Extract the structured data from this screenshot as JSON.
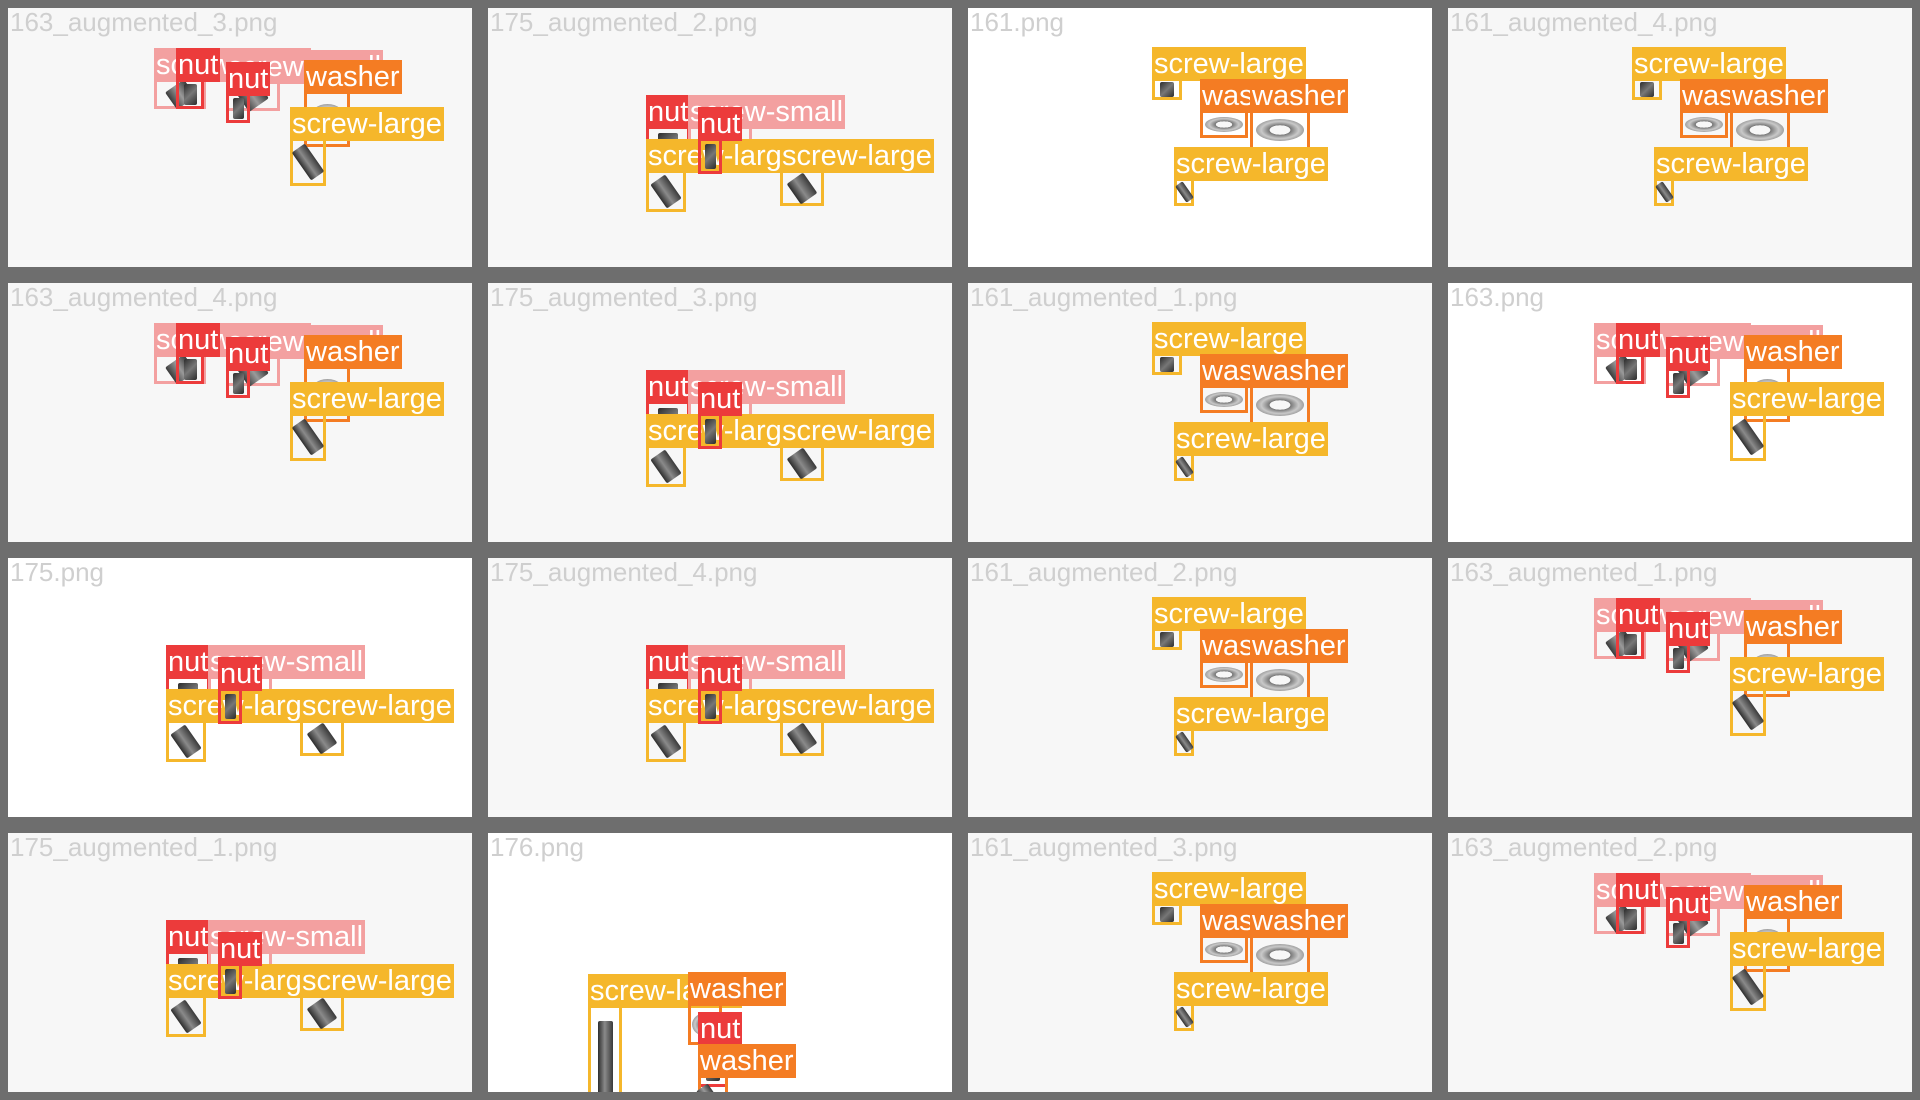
{
  "grid": {
    "columns": 4,
    "rows": 4
  },
  "class_colors": {
    "screw-large": "#f5b72b",
    "washer": "#f47c23",
    "nut": "#ec3b3b",
    "screw-small": "#f3a0a0"
  },
  "tiles": [
    {
      "title": "163_augmented_3.png",
      "layout": "A"
    },
    {
      "title": "175_augmented_2.png",
      "layout": "B"
    },
    {
      "title": "161.png",
      "layout": "C"
    },
    {
      "title": "161_augmented_4.png",
      "layout": "C"
    },
    {
      "title": "163_augmented_4.png",
      "layout": "A"
    },
    {
      "title": "175_augmented_3.png",
      "layout": "B"
    },
    {
      "title": "161_augmented_1.png",
      "layout": "C"
    },
    {
      "title": "163.png",
      "layout": "A"
    },
    {
      "title": "175.png",
      "layout": "B"
    },
    {
      "title": "175_augmented_4.png",
      "layout": "B"
    },
    {
      "title": "161_augmented_2.png",
      "layout": "C"
    },
    {
      "title": "163_augmented_1.png",
      "layout": "A"
    },
    {
      "title": "175_augmented_1.png",
      "layout": "B"
    },
    {
      "title": "176.png",
      "layout": "D"
    },
    {
      "title": "161_augmented_3.png",
      "layout": "C"
    },
    {
      "title": "163_augmented_2.png",
      "layout": "A"
    }
  ],
  "layouts": {
    "A": [
      {
        "label": "screw-small"
      },
      {
        "label": "nut"
      },
      {
        "label": "screw-small"
      },
      {
        "label": "nut"
      },
      {
        "label": "washer"
      },
      {
        "label": "screw-large"
      }
    ],
    "B": [
      {
        "label": "nut"
      },
      {
        "label": "screw-small"
      },
      {
        "label": "screw-large"
      },
      {
        "label": "nut"
      },
      {
        "label": "screw-large"
      }
    ],
    "C": [
      {
        "label": "screw-large"
      },
      {
        "label": "washer"
      },
      {
        "label": "washer"
      },
      {
        "label": "screw-large"
      }
    ],
    "D": [
      {
        "label": "screw-large"
      },
      {
        "label": "washer"
      },
      {
        "label": "nut"
      },
      {
        "label": "washer"
      }
    ]
  }
}
